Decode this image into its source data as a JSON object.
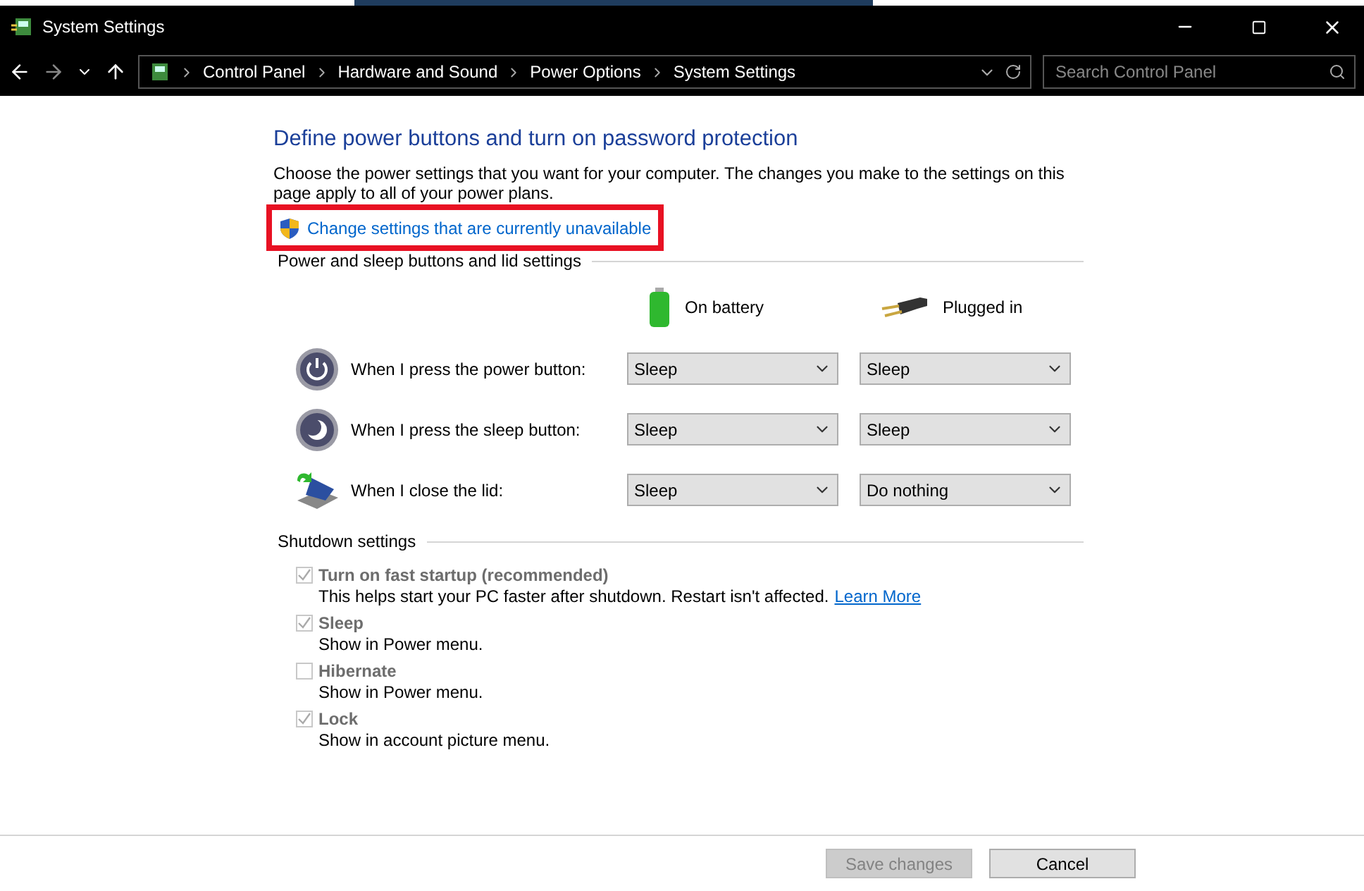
{
  "window": {
    "title": "System Settings"
  },
  "breadcrumb": [
    "Control Panel",
    "Hardware and Sound",
    "Power Options",
    "System Settings"
  ],
  "search": {
    "placeholder": "Search Control Panel"
  },
  "heading": "Define power buttons and turn on password protection",
  "intro": "Choose the power settings that you want for your computer. The changes you make to the settings on this page apply to all of your power plans.",
  "admin_link": {
    "label": "Change settings that are currently unavailable",
    "highlighted": true
  },
  "buttons_section": {
    "title": "Power and sleep buttons and lid settings",
    "columns": [
      {
        "kind": "battery",
        "label": "On battery"
      },
      {
        "kind": "plug",
        "label": "Plugged in"
      }
    ],
    "rows": [
      {
        "kind": "power",
        "label": "When I press the power button:",
        "values": [
          "Sleep",
          "Sleep"
        ]
      },
      {
        "kind": "sleep",
        "label": "When I press the sleep button:",
        "values": [
          "Sleep",
          "Sleep"
        ]
      },
      {
        "kind": "lid",
        "label": "When I close the lid:",
        "values": [
          "Sleep",
          "Do nothing"
        ]
      }
    ]
  },
  "shutdown_section": {
    "title": "Shutdown settings",
    "options": [
      {
        "label": "Turn on fast startup (recommended)",
        "checked": true,
        "disabled": true,
        "description": "This helps start your PC faster after shutdown. Restart isn't affected.",
        "link": "Learn More"
      },
      {
        "label": "Sleep",
        "checked": true,
        "disabled": true,
        "description": "Show in Power menu."
      },
      {
        "label": "Hibernate",
        "checked": false,
        "disabled": true,
        "description": "Show in Power menu."
      },
      {
        "label": "Lock",
        "checked": true,
        "disabled": true,
        "description": "Show in account picture menu."
      }
    ]
  },
  "footer": [
    {
      "label": "Save changes",
      "disabled": true
    },
    {
      "label": "Cancel",
      "disabled": false
    }
  ]
}
